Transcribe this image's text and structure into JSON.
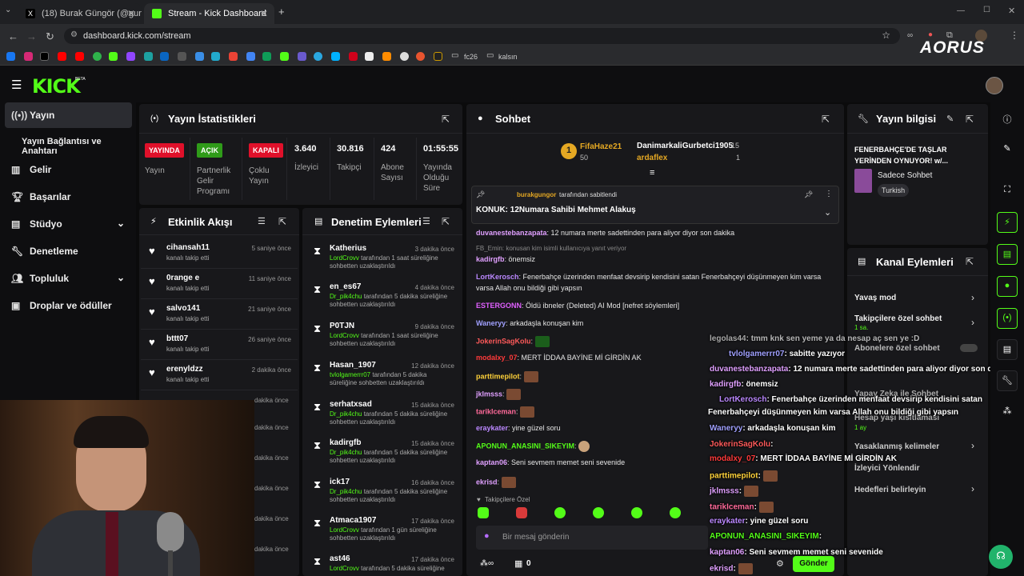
{
  "browser": {
    "tabs": [
      {
        "label": "(18) Burak Güngör (@gungorbur..."
      },
      {
        "label": "Stream - Kick Dashboard"
      }
    ],
    "url": "dashboard.kick.com/stream",
    "bookmarks": [
      "fc26",
      "kalsın"
    ],
    "brand_overlay": "AORUS"
  },
  "app": {
    "logo": "KICK",
    "logo_badge": "BETA"
  },
  "sidebar": {
    "items": [
      {
        "label": "Yayın",
        "icon": "broadcast-icon"
      },
      {
        "label": "Yayın Bağlantısı ve Anahtarı",
        "icon": ""
      },
      {
        "label": "Gelir",
        "icon": "chart-icon"
      },
      {
        "label": "Başarılar",
        "icon": "trophy-icon"
      },
      {
        "label": "Stüdyo",
        "icon": "studio-icon"
      },
      {
        "label": "Denetleme",
        "icon": "wrench-icon"
      },
      {
        "label": "Topluluk",
        "icon": "people-icon"
      },
      {
        "label": "Droplar ve ödüller",
        "icon": "gift-icon"
      }
    ]
  },
  "stats": {
    "title": "Yayın İstatistikleri",
    "items": [
      {
        "badge": "YAYINDA",
        "label": "Yayın",
        "color": "#e0102a"
      },
      {
        "badge": "AÇIK",
        "label": "Partnerlik Gelir Programı",
        "color": "#2f9b19"
      },
      {
        "badge": "KAPALI",
        "label": "Çoklu Yayın",
        "color": "#e0102a"
      },
      {
        "value": "3.640",
        "label": "İzleyici"
      },
      {
        "value": "30.816",
        "label": "Takipçi"
      },
      {
        "value": "424",
        "label": "Abone Sayısı"
      },
      {
        "value": "01:55:55",
        "label": "Yayında Olduğu Süre"
      }
    ]
  },
  "activity": {
    "title": "Etkinlik Akışı",
    "items": [
      {
        "name": "cihansah11",
        "sub": "kanalı takip etti",
        "time": "5 saniye önce"
      },
      {
        "name": "0range e",
        "sub": "kanalı takip etti",
        "time": "11 saniye önce"
      },
      {
        "name": "salvo141",
        "sub": "kanalı takip etti",
        "time": "21 saniye önce"
      },
      {
        "name": "bttt07",
        "sub": "kanalı takip etti",
        "time": "26 saniye önce"
      },
      {
        "name": "erenyldzz",
        "sub": "kanalı takip etti",
        "time": "2 dakika önce"
      }
    ],
    "hidden_times": [
      "dakika önce",
      "dakika önce",
      "dakika önce",
      "dakika önce",
      "dakika önce",
      "dakika önce",
      "dakika önce"
    ]
  },
  "moderation": {
    "title": "Denetim Eylemleri",
    "items": [
      {
        "name": "Katherius",
        "time": "3 dakika önce",
        "mod": "LordCrovv",
        "desc": " tarafından 1 saat süreliğine sohbetten uzaklaştırıldı"
      },
      {
        "name": "en_es67",
        "time": "4 dakika önce",
        "mod": "Dr_pik4chu",
        "desc": " tarafından 5 dakika süreliğine sohbetten uzaklaştırıldı"
      },
      {
        "name": "P0TJN",
        "time": "9 dakika önce",
        "mod": "LordCrovv",
        "desc": " tarafından 1 saat süreliğine sohbetten uzaklaştırıldı"
      },
      {
        "name": "Hasan_1907",
        "time": "12 dakika önce",
        "mod": "tvlolgamerrr07",
        "desc": " tarafından 5 dakika süreliğine sohbetten uzaklaştırıldı"
      },
      {
        "name": "serhatxsad",
        "time": "15 dakika önce",
        "mod": "Dr_pik4chu",
        "desc": " tarafından 5 dakika süreliğine sohbetten uzaklaştırıldı"
      },
      {
        "name": "kadirgfb",
        "time": "15 dakika önce",
        "mod": "Dr_pik4chu",
        "desc": " tarafından 5 dakika süreliğine sohbetten uzaklaştırıldı"
      },
      {
        "name": "ick17",
        "time": "16 dakika önce",
        "mod": "Dr_pik4chu",
        "desc": " tarafından 5 dakika süreliğine sohbetten uzaklaştırıldı"
      },
      {
        "name": "Atmaca1907",
        "time": "17 dakika önce",
        "mod": "LordCrovv",
        "desc": " tarafından 1 gün süreliğine sohbetten uzaklaştırıldı"
      },
      {
        "name": "ast46",
        "time": "17 dakika önce",
        "mod": "LordCrovv",
        "desc": " tarafından 5 dakika süreliğine"
      }
    ]
  },
  "chat": {
    "title": "Sohbet",
    "top": [
      {
        "rank": "1",
        "name": "FifaHaze21",
        "count": "50"
      },
      {
        "name": "DanimarkaliGurbetci1905",
        "count": "15"
      },
      {
        "name": "ardaflex",
        "count": "1"
      }
    ],
    "pinned_by": "burakgungor",
    "pinned_suffix": "tarafından sabitlendi",
    "pinned_text": "KONUK: 12Numara Sahibi Mehmet Alakuş",
    "messages": [
      {
        "user": "duvanestebanzapata",
        "color": "#e0a0ff",
        "text": ": 12 numara merte sadettinden para aliyor diyor son dakika"
      },
      {
        "user": "",
        "color": "#888",
        "text": "FB_Emin: konusan kim isimli kullanıcıya yanıt veriyor"
      },
      {
        "user": "kadirgfb",
        "color": "#e0a0ff",
        "text": ": önemsiz"
      },
      {
        "user": "LortKerosch",
        "color": "#bb88ff",
        "text": ": Fenerbahçe üzerinden menfaat devsirip kendisini satan Fenerbahçeyi düşünmeyen kim varsa"
      },
      {
        "user": "",
        "color": "#fff",
        "text": "varsa Allah onu bildiği gibi yapsın"
      },
      {
        "user": "ESTERGONN",
        "color": "#e060ff",
        "text": ": Öldü ibneler (Deleted) AI Mod [nefret söylemleri]"
      },
      {
        "user": "Waneryy",
        "color": "#a0a0ff",
        "text": ": arkadaşla konuşan kim"
      },
      {
        "user": "JokerinSagKolu",
        "color": "#ff5a5a",
        "text": ":"
      },
      {
        "user": "modalxy_07",
        "color": "#ff3a3a",
        "text": ": MERT İDDAA BAYİNE Mİ GİRDİN AK"
      },
      {
        "user": "parttimepilot",
        "color": "#ffd23a",
        "text": ":"
      },
      {
        "user": "jklmsss",
        "color": "#e0a0ff",
        "text": ":"
      },
      {
        "user": "tarikIceman",
        "color": "#ff6a9a",
        "text": ":"
      },
      {
        "user": "eraykater",
        "color": "#bb88ff",
        "text": ": yine güzel soru"
      },
      {
        "user": "APONUN_ANASINI_SIKEYIM",
        "color": "#53fc18",
        "text": ":"
      },
      {
        "user": "kaptan06",
        "color": "#e0a0ff",
        "text": ": Seni sevmem memet seni sevenide"
      },
      {
        "user": "ekrisd",
        "color": "#e0a0ff",
        "text": ":"
      }
    ],
    "followers_only": "Takipçilere Özel",
    "input_placeholder": "Bir mesaj gönderin",
    "send_label": "Gönder",
    "viewer_count": "0"
  },
  "overlay_chat": [
    {
      "user": "legolas44",
      "text": ": tmm knk sen yeme ya da nesap aç sen ye :D"
    },
    {
      "user": "tvlolgamerrr07",
      "text": ": sabitte yazıyor"
    },
    {
      "user": "duvanestebanzapata",
      "text": ": 12 numara merte sadettinden para aliyor diyor son dakika"
    },
    {
      "user": "kadirgfb",
      "text": ": önemsiz"
    },
    {
      "user": "LortKerosch",
      "text": ": Fenerbahçe üzerinden menfaat devsirip kendisini satan"
    },
    {
      "user": "",
      "text": "Fenerbahçeyi düşünmeyen kim varsa Allah onu bildiği gibi yapsın"
    },
    {
      "user": "Waneryy",
      "text": ": arkadaşla konuşan kim"
    },
    {
      "user": "JokerinSagKolu",
      "text": ":"
    },
    {
      "user": "modalxy_07",
      "text": ": MERT İDDAA BAYİNE Mİ GİRDİN AK"
    },
    {
      "user": "parttimepilot",
      "text": ":"
    },
    {
      "user": "jklmsss",
      "text": ":"
    },
    {
      "user": "tarikIceman",
      "text": ":"
    },
    {
      "user": "eraykater",
      "text": ": yine güzel soru"
    },
    {
      "user": "APONUN_ANASINI_SIKEYIM",
      "text": ":"
    },
    {
      "user": "kaptan06",
      "text": ": Seni sevmem memet seni sevenide"
    },
    {
      "user": "ekrisd",
      "text": ":"
    }
  ],
  "stream_info": {
    "title": "Yayın bilgisi",
    "stream_title": "FENERBAHÇE'DE TAŞLAR YERİNDEN OYNUYOR! w/...",
    "category": "Sadece Sohbet",
    "language": "Turkish"
  },
  "channel_actions": {
    "title": "Kanal Eylemleri",
    "items": [
      {
        "label": "Yavaş mod",
        "sub": ""
      },
      {
        "label": "Takipçilere özel sohbet",
        "sub": "1 sa."
      },
      {
        "label": "Abonelere özel sohbet",
        "sub": ""
      },
      {
        "label": "Yapay Zeka ile Sohbet",
        "sub": ""
      },
      {
        "label": "Hesap yaşı kısıtlaması",
        "sub": "1 ay"
      },
      {
        "label": "Yasaklanmış kelimeler",
        "sub": ""
      },
      {
        "label": "İzleyici Yönlendir",
        "sub": ""
      },
      {
        "label": "Hedefleri belirleyin",
        "sub": ""
      }
    ]
  },
  "colors": {
    "accent": "#53fc18",
    "live": "#e0102a",
    "panel": "#18181b"
  }
}
